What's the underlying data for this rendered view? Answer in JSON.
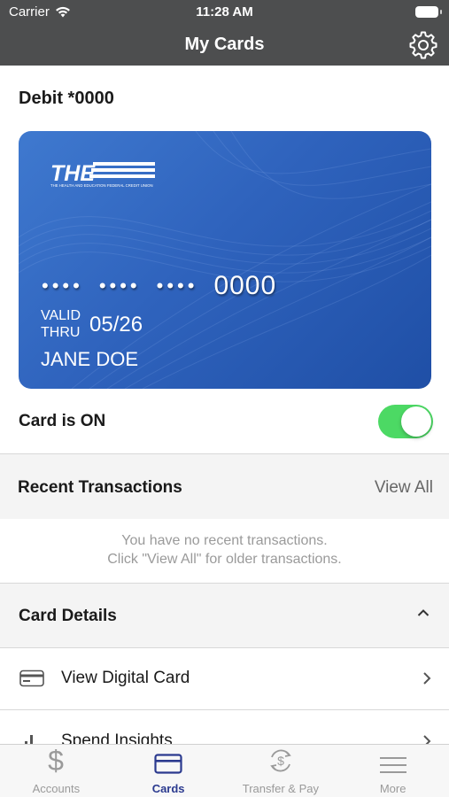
{
  "status_bar": {
    "carrier": "Carrier",
    "time": "11:28 AM"
  },
  "nav": {
    "title": "My Cards"
  },
  "card_section": {
    "title": "Debit *0000"
  },
  "card": {
    "issuer_logo_text": "THE",
    "issuer_tagline": "THE HEALTH AND EDUCATION FEDERAL CREDIT UNION",
    "masked_groups": [
      "••••",
      "••••",
      "••••"
    ],
    "last_four": "0000",
    "valid_thru_line1": "VALID",
    "valid_thru_line2": "THRU",
    "expiry": "05/26",
    "holder": "JANE DOE"
  },
  "card_toggle": {
    "label": "Card is ON",
    "on": true,
    "on_color": "#4cd964"
  },
  "recent_transactions": {
    "title": "Recent Transactions",
    "view_all": "View All",
    "empty_line1": "You have no recent transactions.",
    "empty_line2": "Click \"View All\" for older transactions."
  },
  "card_details": {
    "title": "Card Details",
    "items": [
      {
        "label": "View Digital Card",
        "icon": "credit-card-icon"
      },
      {
        "label": "Spend Insights",
        "icon": "bar-chart-icon"
      }
    ]
  },
  "tab_bar": {
    "active_color": "#2b3a8f",
    "tabs": [
      {
        "label": "Accounts",
        "icon": "dollar-icon"
      },
      {
        "label": "Cards",
        "icon": "card-icon",
        "active": true
      },
      {
        "label": "Transfer & Pay",
        "icon": "transfer-icon"
      },
      {
        "label": "More",
        "icon": "menu-icon"
      }
    ]
  }
}
